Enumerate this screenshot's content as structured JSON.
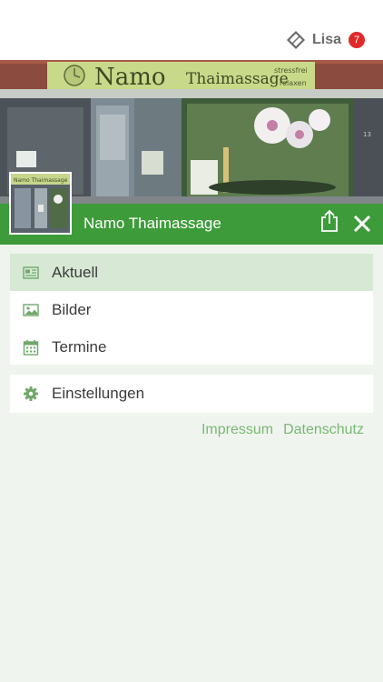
{
  "header": {
    "user_name": "Lisa",
    "notification_count": "7",
    "logo_icon": "diamond-logo-icon"
  },
  "business": {
    "name": "Namo Thaimassage",
    "storefront_sign": {
      "name": "Namo",
      "subtitle": "Thaimassage",
      "tagline_1": "stressfrei",
      "tagline_2": "relaxen"
    },
    "door_number": "13",
    "thumbnail_sign": "Namo Thaimassage"
  },
  "actions": {
    "share_icon": "share-icon",
    "close_icon": "close-icon"
  },
  "menu": {
    "items": [
      {
        "label": "Aktuell",
        "icon": "newspaper-icon",
        "active": true
      },
      {
        "label": "Bilder",
        "icon": "image-icon",
        "active": false
      },
      {
        "label": "Termine",
        "icon": "calendar-icon",
        "active": false
      }
    ],
    "settings": {
      "label": "Einstellungen",
      "icon": "gear-icon"
    }
  },
  "footer": {
    "impressum": "Impressum",
    "datenschutz": "Datenschutz"
  },
  "colors": {
    "brand_green": "#3e9b3a",
    "active_row": "#d7e9d4",
    "link_green": "#7ab874",
    "badge_red": "#e02a2a",
    "background": "#eff5ee"
  }
}
